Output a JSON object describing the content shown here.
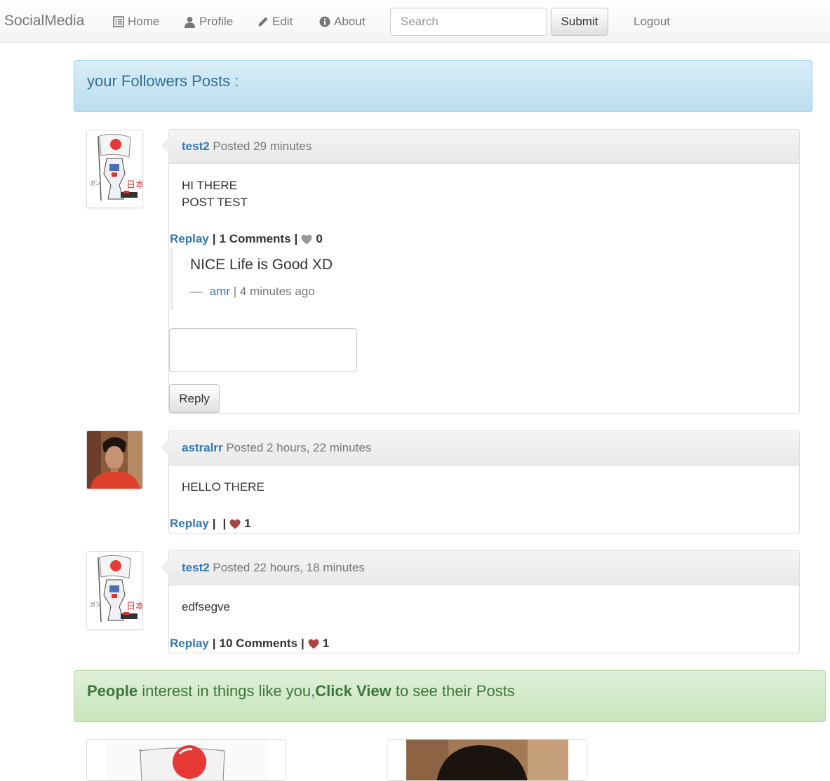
{
  "navbar": {
    "brand": "SocialMedia",
    "items": [
      {
        "label": "Home",
        "icon": "list-icon"
      },
      {
        "label": "Profile",
        "icon": "user-icon"
      },
      {
        "label": "Edit",
        "icon": "pencil-icon"
      },
      {
        "label": "About",
        "icon": "info-icon"
      }
    ],
    "search_placeholder": "Search",
    "submit_label": "Submit",
    "logout_label": "Logout"
  },
  "followers_heading": "your Followers Posts :",
  "posts": [
    {
      "user": "test2",
      "posted": "Posted 29 minutes",
      "lines": [
        "HI THERE",
        "POST TEST"
      ],
      "replay_label": "Replay",
      "comments_label": "1 Comments",
      "likes": "0",
      "liked": false,
      "comments": [
        {
          "text": "NICE Life is Good XD",
          "dash": "—",
          "author": "amr",
          "time": "| 4 minutes ago"
        }
      ],
      "reply_button": "Reply"
    },
    {
      "user": "astralrr",
      "posted": "Posted 2 hours, 22 minutes",
      "lines": [
        "HELLO THERE"
      ],
      "replay_label": "Replay",
      "comments_label": "",
      "likes": "1",
      "liked": true
    },
    {
      "user": "test2",
      "posted": "Posted 22 hours, 18 minutes",
      "lines": [
        "edfsegve"
      ],
      "replay_label": "Replay",
      "comments_label": "10 Comments",
      "likes": "1",
      "liked": true
    }
  ],
  "suggestions": {
    "people": "People",
    "middle": " interest in things like you,",
    "click_view": "Click View",
    "end": " to see their Posts"
  },
  "colors": {
    "link": "#337ab7",
    "heart_liked": "#a94442",
    "heart_unliked": "#999999"
  }
}
